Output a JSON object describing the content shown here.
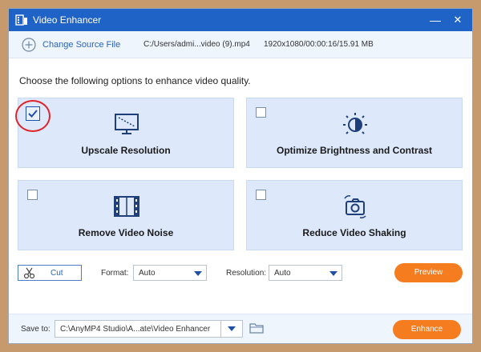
{
  "window": {
    "title": "Video Enhancer",
    "minimize_glyph": "—",
    "close_glyph": "✕"
  },
  "source": {
    "change_label": "Change Source File",
    "file_path": "C:/Users/admi...video (9).mp4",
    "file_info": "1920x1080/00:00:16/15.91 MB"
  },
  "instruction": "Choose the following options to enhance video quality.",
  "options": [
    {
      "label": "Upscale Resolution",
      "checked": true,
      "icon": "upscale-monitor-icon"
    },
    {
      "label": "Optimize Brightness and Contrast",
      "checked": false,
      "icon": "brightness-icon"
    },
    {
      "label": "Remove Video Noise",
      "checked": false,
      "icon": "film-strip-icon"
    },
    {
      "label": "Reduce Video Shaking",
      "checked": false,
      "icon": "stabilize-camera-icon"
    }
  ],
  "toolbar": {
    "cut_label": "Cut",
    "format_label": "Format:",
    "format_value": "Auto",
    "resolution_label": "Resolution:",
    "resolution_value": "Auto",
    "preview_label": "Preview"
  },
  "footer": {
    "save_label": "Save to:",
    "save_path": "C:\\AnyMP4 Studio\\A...ate\\Video Enhancer",
    "enhance_label": "Enhance"
  },
  "colors": {
    "titlebar": "#1f63c6",
    "accent": "#f57c1f",
    "option_bg": "#dde9fb",
    "highlight": "#e0222a"
  }
}
